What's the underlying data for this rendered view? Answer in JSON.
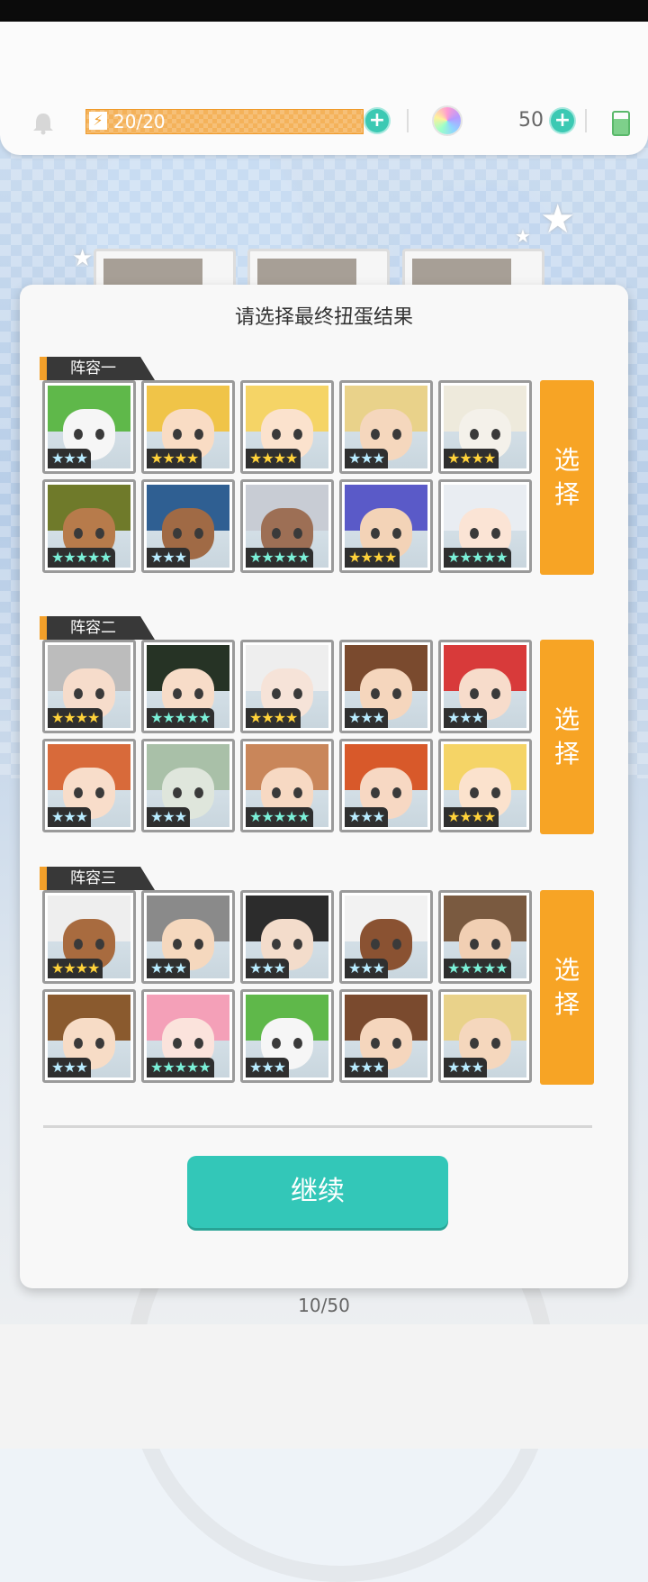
{
  "status": {
    "energy": "20/20",
    "gems": "50"
  },
  "modal": {
    "title": "请选择最终扭蛋结果",
    "continue_label": "继续",
    "teams": [
      {
        "name": "阵容一",
        "select_label": [
          "选",
          "择"
        ],
        "characters": [
          {
            "stars": "★★★",
            "tier": "silver",
            "hair": "#5fb84a",
            "skin": "#f6f6f6"
          },
          {
            "stars": "★★★★",
            "tier": "gold",
            "hair": "#f0c448",
            "skin": "#f9dcc4"
          },
          {
            "stars": "★★★★",
            "tier": "gold",
            "hair": "#f5d466",
            "skin": "#fbe2cd"
          },
          {
            "stars": "★★★",
            "tier": "silver",
            "hair": "#e9d28a",
            "skin": "#f5d7bd"
          },
          {
            "stars": "★★★★",
            "tier": "gold",
            "hair": "#eeeadc",
            "skin": "#f4f1ea"
          },
          {
            "stars": "★★★★★",
            "tier": "rainbow",
            "hair": "#6f7a2a",
            "skin": "#b77b4b"
          },
          {
            "stars": "★★★",
            "tier": "silver",
            "hair": "#2f5f92",
            "skin": "#a06a45"
          },
          {
            "stars": "★★★★★",
            "tier": "rainbow",
            "hair": "#c8ccd4",
            "skin": "#9d6f55"
          },
          {
            "stars": "★★★★",
            "tier": "gold",
            "hair": "#5a5ac8",
            "skin": "#f3d3b7"
          },
          {
            "stars": "★★★★★",
            "tier": "rainbow",
            "hair": "#e9edf2",
            "skin": "#fbe4d5"
          }
        ]
      },
      {
        "name": "阵容二",
        "select_label": [
          "选",
          "择"
        ],
        "characters": [
          {
            "stars": "★★★★",
            "tier": "gold",
            "hair": "#bcbcbc",
            "skin": "#f6dccb"
          },
          {
            "stars": "★★★★★",
            "tier": "rainbow",
            "hair": "#263325",
            "skin": "#f7dcc8"
          },
          {
            "stars": "★★★★",
            "tier": "gold",
            "hair": "#eeeeee",
            "skin": "#f6e3d8"
          },
          {
            "stars": "★★★",
            "tier": "silver",
            "hair": "#7a4a2e",
            "skin": "#f5d6bd"
          },
          {
            "stars": "★★★",
            "tier": "silver",
            "hair": "#d83a3a",
            "skin": "#f7dccb"
          },
          {
            "stars": "★★★",
            "tier": "silver",
            "hair": "#d86a3a",
            "skin": "#f8ddca"
          },
          {
            "stars": "★★★",
            "tier": "silver",
            "hair": "#a9c0a8",
            "skin": "#dfe6dc"
          },
          {
            "stars": "★★★★★",
            "tier": "rainbow",
            "hair": "#c9865a",
            "skin": "#f7d9c3"
          },
          {
            "stars": "★★★",
            "tier": "silver",
            "hair": "#d8592a",
            "skin": "#f7d8c3"
          },
          {
            "stars": "★★★★",
            "tier": "gold",
            "hair": "#f5d466",
            "skin": "#fbe2cd"
          }
        ]
      },
      {
        "name": "阵容三",
        "select_label": [
          "选",
          "择"
        ],
        "characters": [
          {
            "stars": "★★★★",
            "tier": "gold",
            "hair": "#eeeeee",
            "skin": "#a86b3f"
          },
          {
            "stars": "★★★",
            "tier": "silver",
            "hair": "#8a8a8a",
            "skin": "#f5d8be"
          },
          {
            "stars": "★★★",
            "tier": "silver",
            "hair": "#2c2c2c",
            "skin": "#f3dccb"
          },
          {
            "stars": "★★★",
            "tier": "silver",
            "hair": "#f2f2f2",
            "skin": "#8a5232"
          },
          {
            "stars": "★★★★★",
            "tier": "rainbow",
            "hair": "#7a5a40",
            "skin": "#f1cfb3"
          },
          {
            "stars": "★★★",
            "tier": "silver",
            "hair": "#8a5a2e",
            "skin": "#f7dcc6"
          },
          {
            "stars": "★★★★★",
            "tier": "rainbow",
            "hair": "#f4a0b8",
            "skin": "#fbe3dc"
          },
          {
            "stars": "★★★",
            "tier": "silver",
            "hair": "#5fb84a",
            "skin": "#f6f6f6"
          },
          {
            "stars": "★★★",
            "tier": "silver",
            "hair": "#7a4a2e",
            "skin": "#f5d6bd"
          },
          {
            "stars": "★★★",
            "tier": "silver",
            "hair": "#e9d28a",
            "skin": "#f5d7bd"
          }
        ]
      }
    ]
  },
  "progress": "10/50",
  "colors": {
    "accent_orange": "#f7a425",
    "teal_button": "#33c7b8",
    "tag_dark": "#383838"
  },
  "icons": [
    "bell-icon",
    "lightning-icon",
    "plus-icon",
    "gem-icon",
    "battery-icon"
  ]
}
